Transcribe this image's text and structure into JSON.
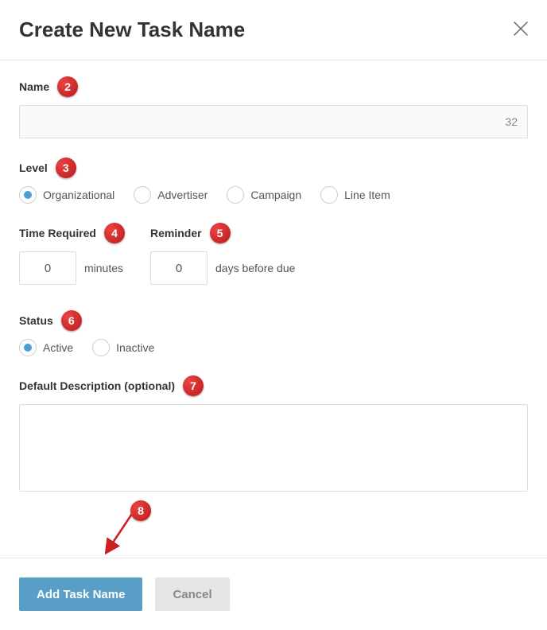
{
  "dialog": {
    "title": "Create New Task Name",
    "badges": {
      "name": "2",
      "level": "3",
      "timeRequired": "4",
      "reminder": "5",
      "status": "6",
      "defaultDescription": "7",
      "addTaskName": "8"
    },
    "fields": {
      "name": {
        "label": "Name",
        "counter": "32"
      },
      "level": {
        "label": "Level",
        "options": [
          {
            "label": "Organizational",
            "selected": true
          },
          {
            "label": "Advertiser",
            "selected": false
          },
          {
            "label": "Campaign",
            "selected": false
          },
          {
            "label": "Line Item",
            "selected": false
          }
        ]
      },
      "timeRequired": {
        "label": "Time Required",
        "value": "0",
        "unit": "minutes"
      },
      "reminder": {
        "label": "Reminder",
        "value": "0",
        "unit": "days before due"
      },
      "status": {
        "label": "Status",
        "options": [
          {
            "label": "Active",
            "selected": true
          },
          {
            "label": "Inactive",
            "selected": false
          }
        ]
      },
      "defaultDescription": {
        "label": "Default Description (optional)",
        "value": ""
      }
    },
    "footer": {
      "primary": "Add Task Name",
      "secondary": "Cancel"
    }
  }
}
